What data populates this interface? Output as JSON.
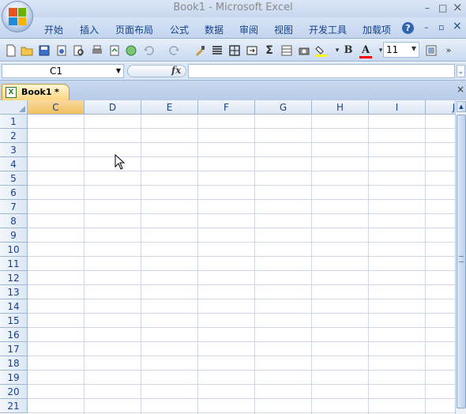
{
  "window": {
    "title": "Book1 - Microsoft Excel",
    "minimize_glyph": "–",
    "maximize_glyph": "□",
    "close_glyph": "×"
  },
  "ribbon": {
    "tabs": [
      "开始",
      "插入",
      "页面布局",
      "公式",
      "数据",
      "审阅",
      "视图",
      "开发工具",
      "加载项"
    ],
    "help_glyph": "?",
    "doc_min": "–",
    "doc_restore": "▫",
    "doc_close": "×"
  },
  "toolbar": {
    "icons": [
      "new-icon",
      "open-icon",
      "save-icon",
      "permission-icon",
      "print-preview-icon",
      "print-icon",
      "export-pdf-icon",
      "web-icon",
      "undo-icon",
      "redo-icon",
      "format-painter-icon",
      "align-icon",
      "borders-icon",
      "merge-icon",
      "autosum-icon",
      "insert-icon",
      "camera-icon",
      "fill-color-icon",
      "bold-icon",
      "font-color-icon"
    ],
    "bold_label": "B",
    "font_color_label": "A",
    "sigma_label": "Σ",
    "font_size": "11",
    "overflow_label": "»",
    "fill_color": "#ffff00",
    "font_color": "#ff0000"
  },
  "formula_bar": {
    "name_box": "C1",
    "fx_label": "fx",
    "formula": "",
    "expand_glyph": "⌄"
  },
  "workbook": {
    "tab_name": "Book1",
    "dirty_marker": "*",
    "close_glyph": "×"
  },
  "sheet": {
    "columns": [
      "C",
      "D",
      "E",
      "F",
      "G",
      "H",
      "I",
      "J"
    ],
    "active_column": "C",
    "rows": [
      "1",
      "2",
      "3",
      "4",
      "5",
      "6",
      "7",
      "8",
      "9",
      "10",
      "11",
      "12",
      "13",
      "14",
      "15",
      "16",
      "17",
      "18",
      "19",
      "20",
      "21"
    ]
  }
}
